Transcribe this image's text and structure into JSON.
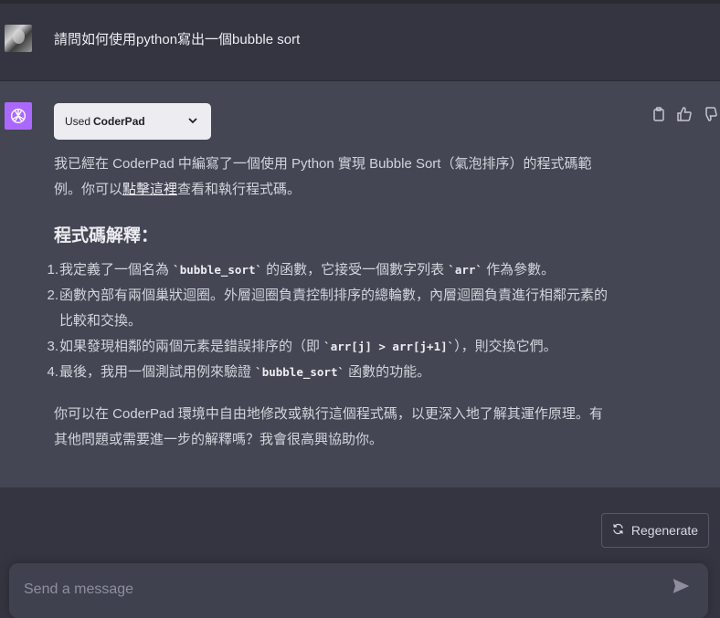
{
  "user_message": "請問如何使用python寫出一個bubble sort",
  "plugin": {
    "used_label": "Used",
    "name": "CoderPad"
  },
  "assistant": {
    "intro_before_link": "我已經在 CoderPad 中編寫了一個使用 Python 實現 Bubble Sort（氣泡排序）的程式碼範",
    "intro_line2_prefix": "例。你可以",
    "intro_link": "點擊這裡",
    "intro_line2_suffix": "查看和執行程式碼。",
    "heading": "程式碼解釋：",
    "items": [
      {
        "num": "1.",
        "pre": "我定義了一個名為 ",
        "code": "`bubble_sort`",
        "post": " 的函數，它接受一個數字列表 ",
        "code2": "`arr`",
        "post2": " 作為參數。"
      },
      {
        "num": "2.",
        "line1": "函數內部有兩個巢狀迴圈。外層迴圈負責控制排序的總輪數，內層迴圈負責進行相鄰元素的",
        "line2": "比較和交換。"
      },
      {
        "num": "3.",
        "pre": "如果發現相鄰的兩個元素是錯誤排序的（即 ",
        "code": "`arr[j] > arr[j+1]`",
        "post": "），則交換它們。"
      },
      {
        "num": "4.",
        "pre": "最後，我用一個測試用例來驗證 ",
        "code": "`bubble_sort`",
        "post": " 函數的功能。"
      }
    ],
    "closing_line1": "你可以在 CoderPad 環境中自由地修改或執行這個程式碼，以更深入地了解其運作原理。有",
    "closing_line2": "其他問題或需要進一步的解釋嗎？我會很高興協助你。"
  },
  "regenerate_label": "Regenerate",
  "composer": {
    "placeholder": "Send a message",
    "value": ""
  },
  "colors": {
    "background": "#343541",
    "assistant_bg": "#444654",
    "gpt_logo": "#ab68ff"
  }
}
